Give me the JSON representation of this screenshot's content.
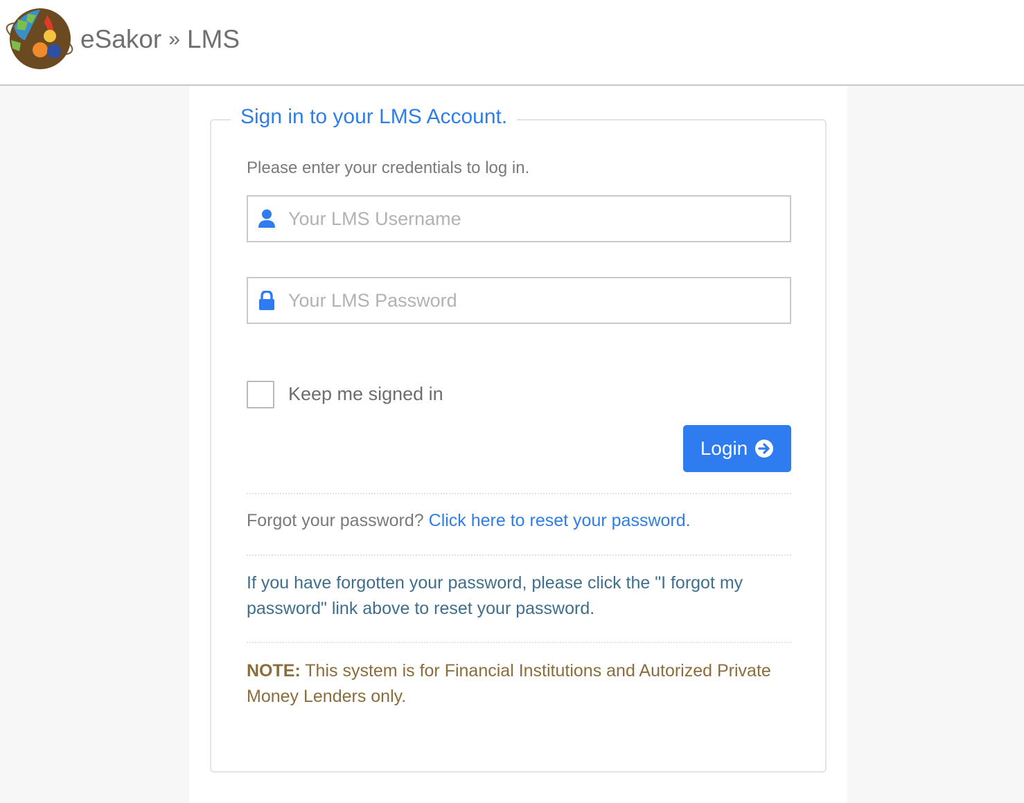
{
  "header": {
    "logo_icon": "globe-logo-icon",
    "brand_name": "eSakor",
    "separator": "»",
    "section": "LMS"
  },
  "login": {
    "legend": "Sign in to your LMS Account.",
    "intro": "Please enter your credentials to log in.",
    "username": {
      "placeholder": "Your LMS Username",
      "value": "",
      "icon": "user-icon"
    },
    "password": {
      "placeholder": "Your LMS Password",
      "value": "",
      "icon": "lock-icon"
    },
    "remember_label": "Keep me signed in",
    "remember_checked": false,
    "login_label": "Login",
    "login_icon": "arrow-circle-right-icon"
  },
  "forgot": {
    "question": "Forgot your password?",
    "link": "Click here to reset your password."
  },
  "help": "If you have forgotten your password, please click the \"I forgot my password\" link above to reset your password.",
  "note": {
    "label": "NOTE:",
    "text": "This system is for Financial Institutions and Autorized Private Money Lenders only."
  },
  "colors": {
    "accent": "#2f7bf0",
    "link": "#2f7ee8",
    "help_text": "#3f6f8c",
    "note_text": "#8a6d3b"
  }
}
